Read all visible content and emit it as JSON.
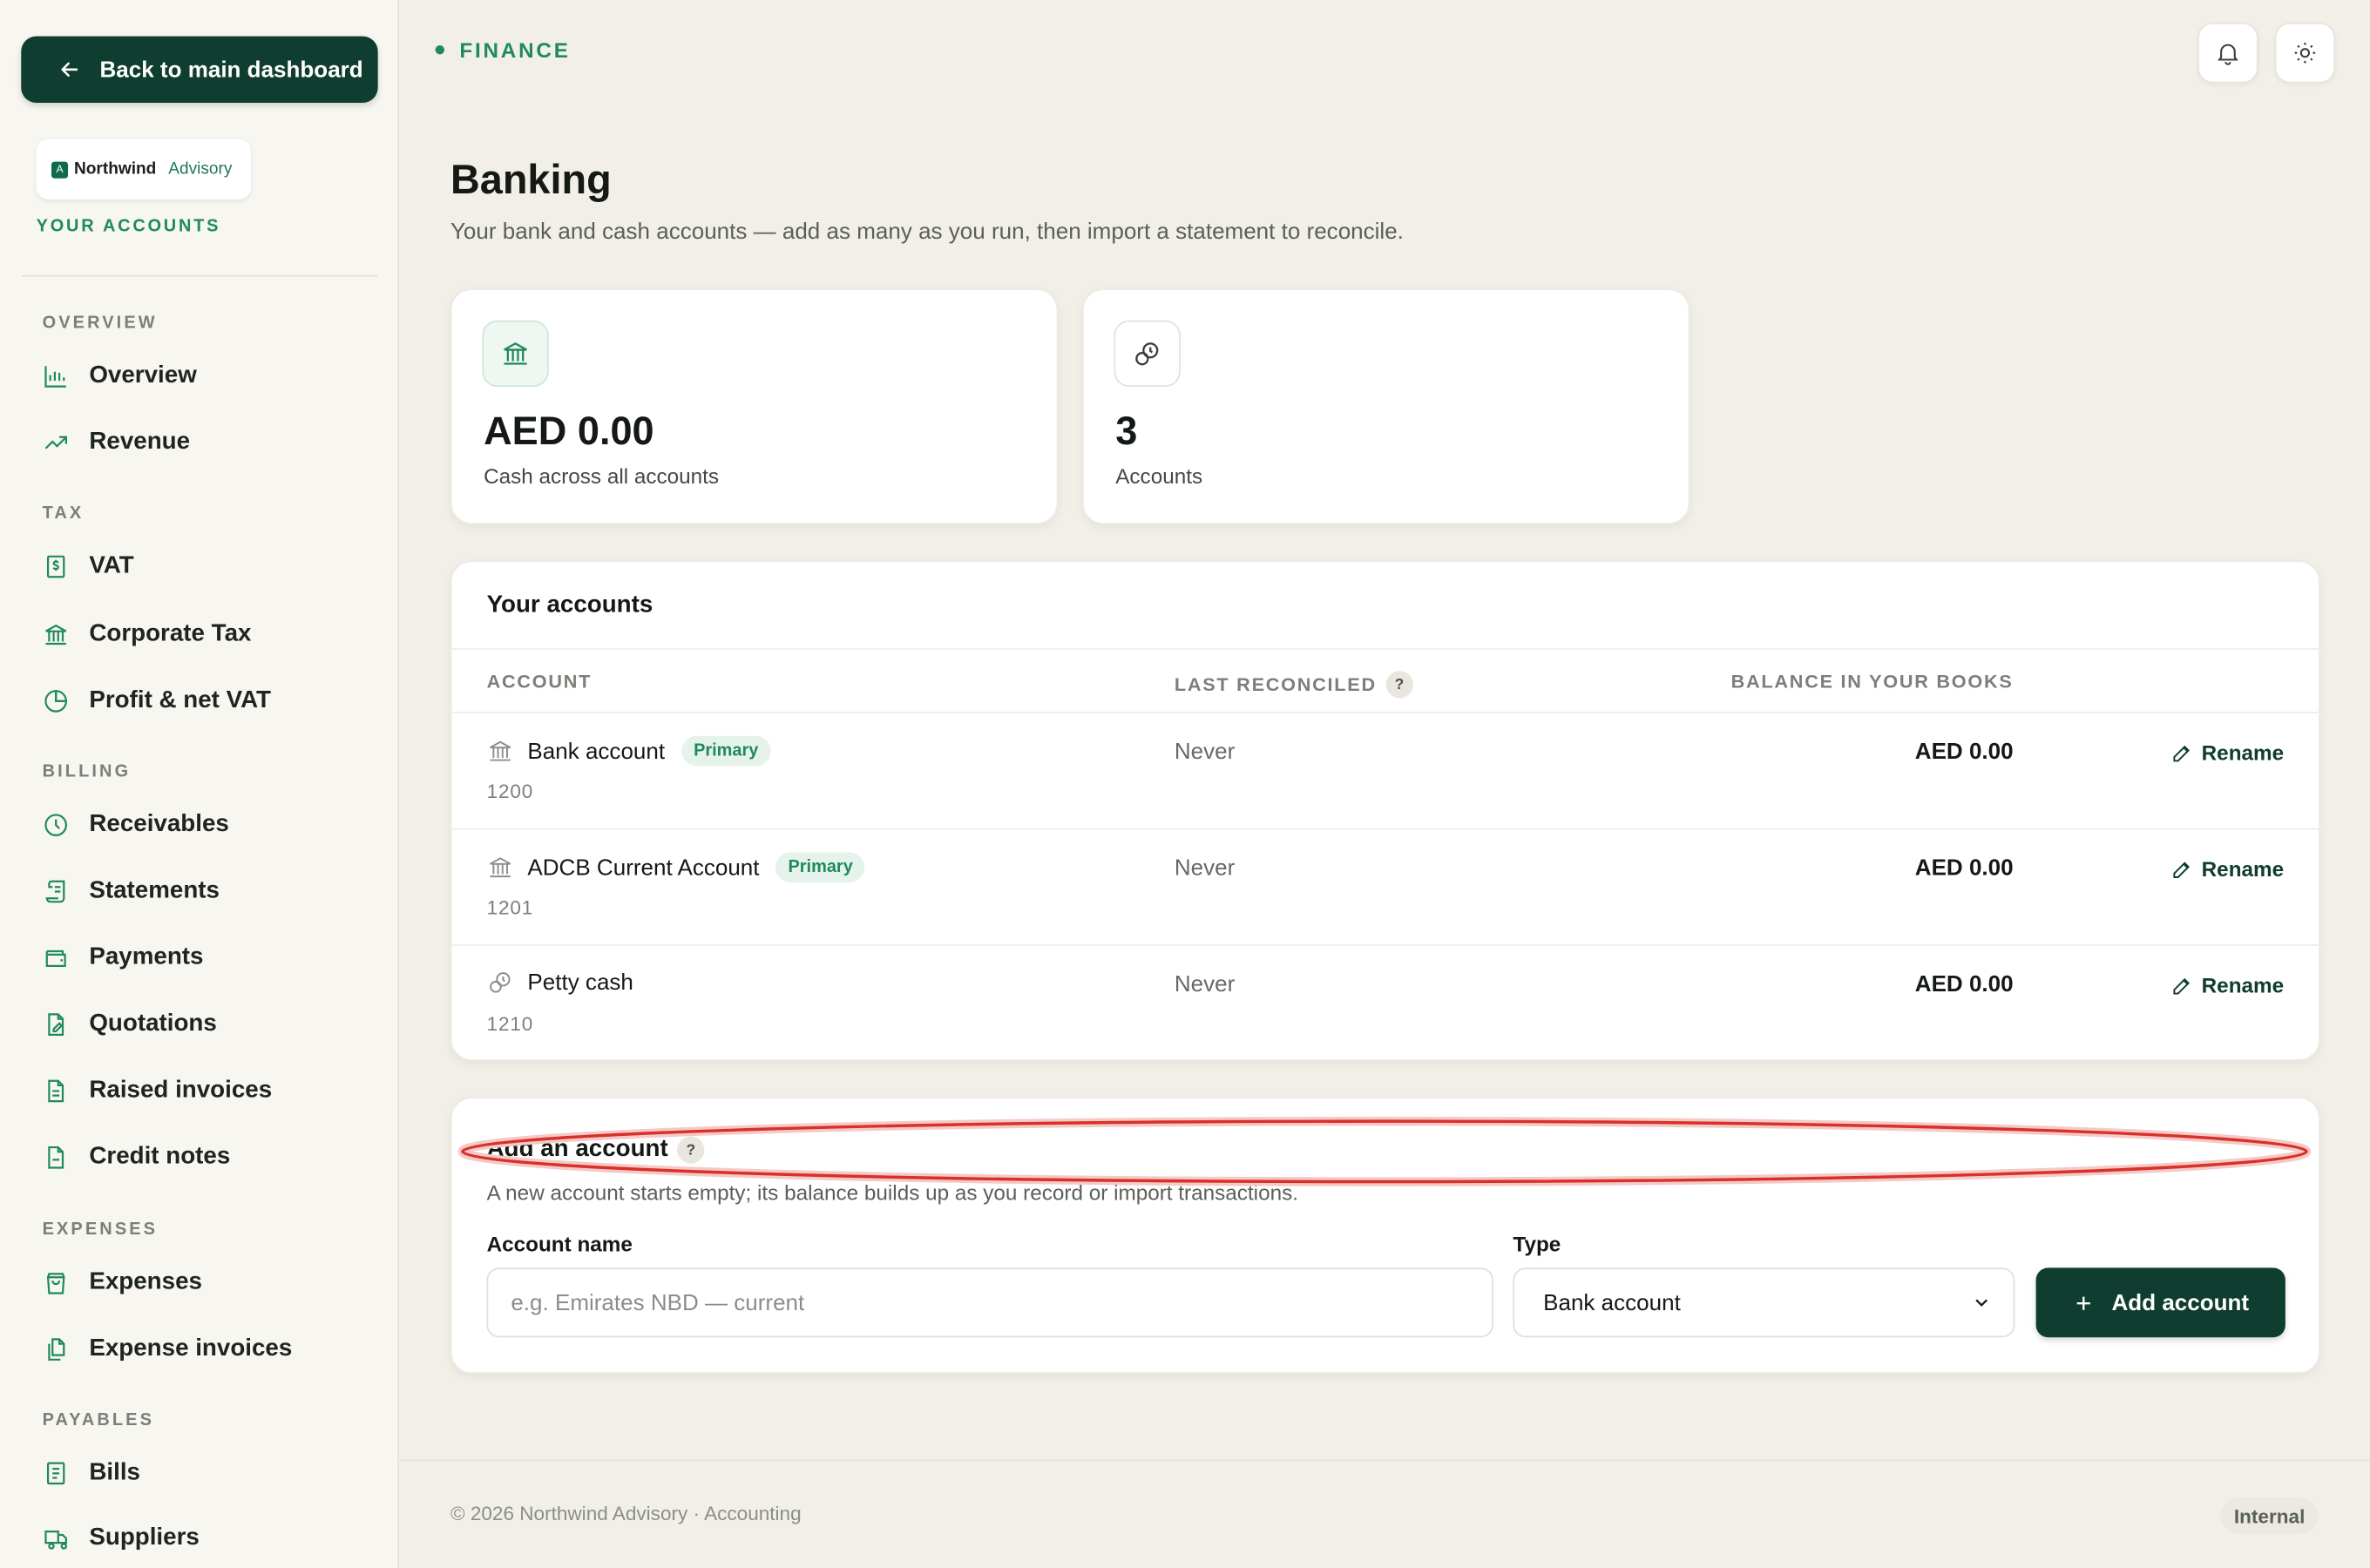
{
  "sidebar": {
    "back_label": "Back to main dashboard",
    "brand": {
      "mark": "A",
      "name": "Northwind",
      "sub": "Advisory"
    },
    "your_accounts": "YOUR ACCOUNTS",
    "sections": {
      "overview": "OVERVIEW",
      "tax": "TAX",
      "billing": "BILLING",
      "expenses": "EXPENSES",
      "payables": "PAYABLES"
    },
    "items": {
      "overview": "Overview",
      "revenue": "Revenue",
      "vat": "VAT",
      "corporate_tax": "Corporate Tax",
      "profit_net_vat": "Profit & net VAT",
      "receivables": "Receivables",
      "statements": "Statements",
      "payments": "Payments",
      "quotations": "Quotations",
      "raised_invoices": "Raised invoices",
      "credit_notes": "Credit notes",
      "expenses": "Expenses",
      "expense_invoices": "Expense invoices",
      "bills": "Bills",
      "suppliers": "Suppliers"
    }
  },
  "topbar": {
    "crumb": "FINANCE",
    "icons": [
      "bell-icon",
      "sun-icon"
    ]
  },
  "page": {
    "title": "Banking",
    "subtitle": "Your bank and cash accounts — add as many as you run, then import a statement to reconcile."
  },
  "stats": [
    {
      "value": "AED 0.00",
      "label": "Cash across all accounts",
      "icon": "bank-icon"
    },
    {
      "value": "3",
      "label": "Accounts",
      "icon": "coins-icon"
    }
  ],
  "accounts_table": {
    "title": "Your accounts",
    "headers": {
      "account": "ACCOUNT",
      "last_reconciled": "LAST RECONCILED",
      "balance": "BALANCE IN YOUR BOOKS"
    },
    "help": "?",
    "rows": [
      {
        "name": "Bank account",
        "badge": "Primary",
        "code": "1200",
        "reconciled": "Never",
        "balance": "AED 0.00",
        "action": "Rename",
        "icon": "bank-icon"
      },
      {
        "name": "ADCB Current Account",
        "badge": "Primary",
        "code": "1201",
        "reconciled": "Never",
        "balance": "AED 0.00",
        "action": "Rename",
        "icon": "bank-icon"
      },
      {
        "name": "Petty cash",
        "badge": "",
        "code": "1210",
        "reconciled": "Never",
        "balance": "AED 0.00",
        "action": "Rename",
        "icon": "coins-icon"
      }
    ]
  },
  "add_account": {
    "title": "Add an account",
    "help": "?",
    "description": "A new account starts empty; its balance builds up as you record or import transactions.",
    "name_label": "Account name",
    "name_placeholder": "e.g. Emirates NBD — current",
    "type_label": "Type",
    "type_value": "Bank account",
    "button": "Add account"
  },
  "footer": {
    "text": "© 2026 Northwind Advisory · Accounting",
    "badge": "Internal"
  },
  "colors": {
    "primary": "#0f3d30",
    "accent": "#1f8a5b",
    "annotation": "#d9302a"
  }
}
